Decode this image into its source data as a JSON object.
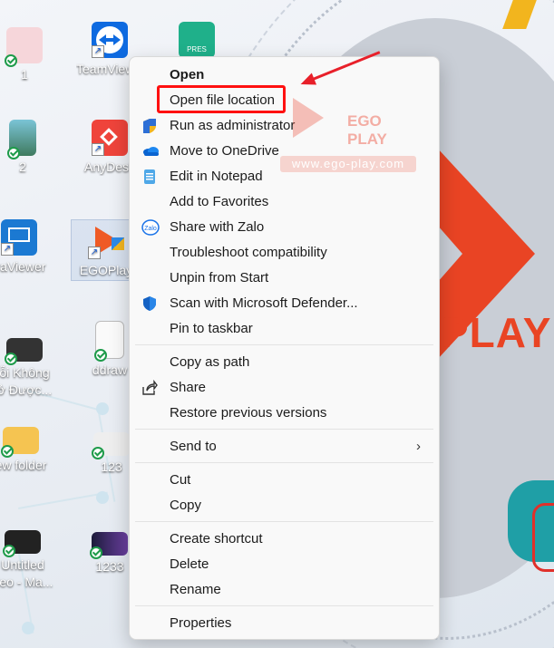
{
  "desktop": {
    "icons": [
      {
        "name": "icon-1",
        "label": "1"
      },
      {
        "name": "icon-teamviewer",
        "label": "TeamViewer"
      },
      {
        "name": "icon-pres",
        "label": "",
        "badge": "PRES"
      },
      {
        "name": "icon-2",
        "label": "2"
      },
      {
        "name": "icon-anydesk",
        "label": "AnyDesk"
      },
      {
        "name": "icon-ultraviewer",
        "label": "traViewer"
      },
      {
        "name": "icon-egoplay",
        "label": "EGOPlay"
      },
      {
        "name": "icon-video",
        "label": "ỗi Không\nở Được..."
      },
      {
        "name": "icon-ddraw",
        "label": "ddraw"
      },
      {
        "name": "icon-new-folder",
        "label": "ew folder"
      },
      {
        "name": "icon-123",
        "label": "123"
      },
      {
        "name": "icon-untitled-video",
        "label": "Untitled\ndeo - Ma..."
      },
      {
        "name": "icon-1233",
        "label": "1233"
      }
    ]
  },
  "wallpaper": {
    "brand_text": "PLAY",
    "watermark_brand": "EGO PLAY",
    "watermark_url": "www.ego-play.com"
  },
  "menu": {
    "items": [
      {
        "label": "Open",
        "bold": true,
        "icon": ""
      },
      {
        "label": "Open file location",
        "bold": false,
        "icon": ""
      },
      {
        "label": "Run as administrator",
        "bold": false,
        "icon": "uac-shield-icon"
      },
      {
        "label": "Move to OneDrive",
        "bold": false,
        "icon": "onedrive-icon"
      },
      {
        "label": "Edit in Notepad",
        "bold": false,
        "icon": "notepad-icon"
      },
      {
        "label": "Add to Favorites",
        "bold": false,
        "icon": ""
      },
      {
        "label": "Share with Zalo",
        "bold": false,
        "icon": "zalo-icon"
      },
      {
        "label": "Troubleshoot compatibility",
        "bold": false,
        "icon": ""
      },
      {
        "label": "Unpin from Start",
        "bold": false,
        "icon": ""
      },
      {
        "label": "Scan with Microsoft Defender...",
        "bold": false,
        "icon": "defender-icon"
      },
      {
        "label": "Pin to taskbar",
        "bold": false,
        "icon": ""
      },
      {
        "label": "Copy as path",
        "bold": false,
        "icon": ""
      },
      {
        "label": "Share",
        "bold": false,
        "icon": "share-icon"
      },
      {
        "label": "Restore previous versions",
        "bold": false,
        "icon": ""
      },
      {
        "label": "Send to",
        "bold": false,
        "icon": "",
        "submenu": true
      },
      {
        "label": "Cut",
        "bold": false,
        "icon": ""
      },
      {
        "label": "Copy",
        "bold": false,
        "icon": ""
      },
      {
        "label": "Create shortcut",
        "bold": false,
        "icon": ""
      },
      {
        "label": "Delete",
        "bold": false,
        "icon": ""
      },
      {
        "label": "Rename",
        "bold": false,
        "icon": ""
      },
      {
        "label": "Properties",
        "bold": false,
        "icon": ""
      }
    ]
  },
  "annotation": {
    "highlighted_item": "Open file location",
    "arrow_color": "#e8202a"
  },
  "colors": {
    "accent_red": "#e94424",
    "highlight_red": "#ff1010",
    "teal": "#1f9fa6"
  }
}
